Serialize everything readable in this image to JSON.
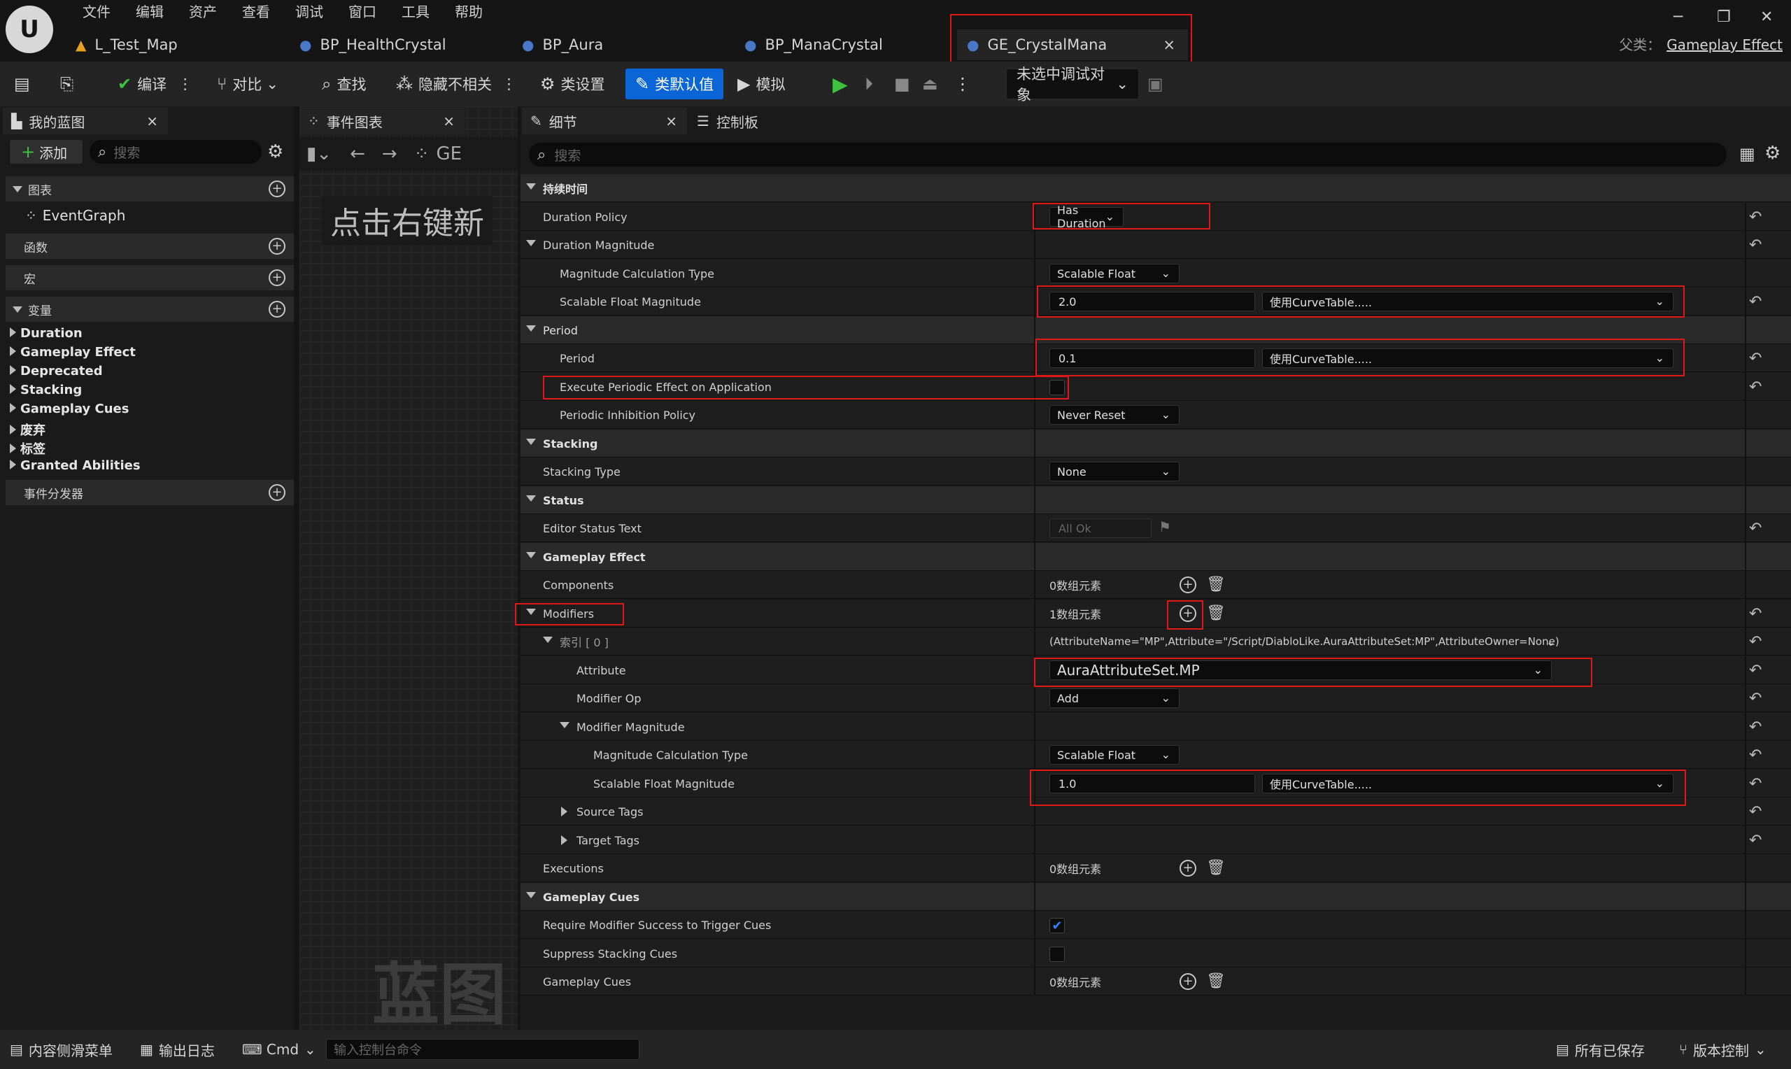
{
  "menu": [
    "文件",
    "编辑",
    "资产",
    "查看",
    "调试",
    "窗口",
    "工具",
    "帮助"
  ],
  "tabs": [
    {
      "label": "L_Test_Map",
      "icon": "map-icon"
    },
    {
      "label": "BP_HealthCrystal",
      "icon": "blueprint-icon"
    },
    {
      "label": "BP_Aura",
      "icon": "blueprint-icon"
    },
    {
      "label": "BP_ManaCrystal",
      "icon": "blueprint-icon"
    },
    {
      "label": "GE_CrystalMana",
      "icon": "blueprint-icon"
    }
  ],
  "parent_label": "父类：",
  "parent_class": "Gameplay Effect",
  "toolbar": {
    "compile": "编译",
    "diff": "对比",
    "find": "查找",
    "hide": "隐藏不相关",
    "class_settings": "类设置",
    "class_defaults": "类默认值",
    "simulate": "模拟",
    "debug_object": "未选中调试对象"
  },
  "left": {
    "tab": "我的蓝图",
    "add": "添加",
    "search": "搜索",
    "graphs": "图表",
    "event_graph": "EventGraph",
    "functions": "函数",
    "macros": "宏",
    "variables": "变量",
    "var_items": [
      "Duration",
      "Gameplay Effect",
      "Deprecated",
      "Stacking",
      "Gameplay Cues",
      "废弃",
      "标签",
      "Granted Abilities"
    ],
    "dispatchers": "事件分发器"
  },
  "graph": {
    "tab": "事件图表",
    "hint": "点击右键新",
    "watermark": "蓝图",
    "ge": "GE"
  },
  "details": {
    "tab": "细节",
    "tab2": "控制板",
    "search": "搜索",
    "dur_cat": "持续时间",
    "duration_policy": "Duration Policy",
    "duration_policy_val": "Has Duration",
    "duration_magnitude": "Duration Magnitude",
    "mag_calc_type": "Magnitude Calculation Type",
    "scalable_float": "Scalable Float",
    "scalable_float_mag": "Scalable Float Magnitude",
    "dur_value": "2.0",
    "curve": "使用CurveTable.....",
    "period_cat": "Period",
    "period": "Period",
    "period_value": "0.1",
    "exec_periodic": "Execute Periodic Effect on Application",
    "periodic_inhibition": "Periodic Inhibition Policy",
    "never_reset": "Never Reset",
    "stacking_cat": "Stacking",
    "stacking_type": "Stacking Type",
    "none": "None",
    "status_cat": "Status",
    "editor_status": "Editor Status Text",
    "all_ok": "All Ok",
    "ge_cat": "Gameplay Effect",
    "components": "Components",
    "zero_elems": "0数组元素",
    "modifiers": "Modifiers",
    "one_elem": "1数组元素",
    "index0": "索引 [ 0 ]",
    "index0_val": "(AttributeName=\"MP\",Attribute=\"/Script/DiabloLike.AuraAttributeSet:MP\",AttributeOwner=None)",
    "attribute": "Attribute",
    "attribute_val": "AuraAttributeSet.MP",
    "modifier_op": "Modifier Op",
    "add": "Add",
    "modifier_magnitude": "Modifier Magnitude",
    "mod_value": "1.0",
    "source_tags": "Source Tags",
    "target_tags": "Target Tags",
    "executions": "Executions",
    "cues_cat": "Gameplay Cues",
    "require_mod": "Require Modifier Success to Trigger Cues",
    "suppress": "Suppress Stacking Cues",
    "gameplay_cues": "Gameplay Cues"
  },
  "status": {
    "content_drawer": "内容侧滑菜单",
    "output_log": "输出日志",
    "cmd": "Cmd",
    "console_placeholder": "输入控制台命令",
    "all_saved": "所有已保存",
    "source_control": "版本控制"
  }
}
